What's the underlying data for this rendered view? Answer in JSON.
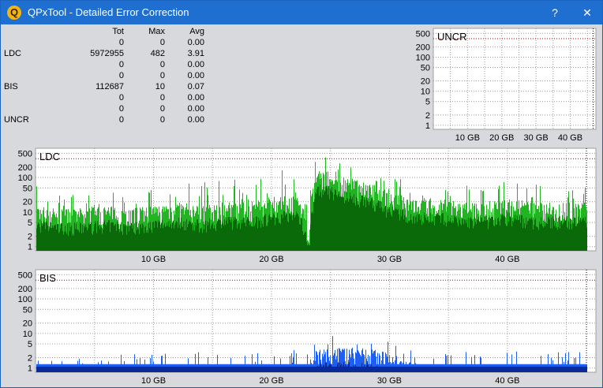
{
  "window": {
    "title": "QPxTool - Detailed Error Correction",
    "help_label": "?",
    "close_label": "✕",
    "app_icon_letter": "Q"
  },
  "stats": {
    "headers": [
      "Tot",
      "Max",
      "Avg"
    ],
    "rows": [
      {
        "label": "",
        "tot": "0",
        "max": "0",
        "avg": "0.00"
      },
      {
        "label": "LDC",
        "tot": "5972955",
        "max": "482",
        "avg": "3.91"
      },
      {
        "label": "",
        "tot": "0",
        "max": "0",
        "avg": "0.00"
      },
      {
        "label": "",
        "tot": "0",
        "max": "0",
        "avg": "0.00"
      },
      {
        "label": "BIS",
        "tot": "112687",
        "max": "10",
        "avg": "0.07"
      },
      {
        "label": "",
        "tot": "0",
        "max": "0",
        "avg": "0.00"
      },
      {
        "label": "",
        "tot": "0",
        "max": "0",
        "avg": "0.00"
      },
      {
        "label": "UNCR",
        "tot": "0",
        "max": "0",
        "avg": "0.00"
      }
    ]
  },
  "colors": {
    "ldc_light": "#22b422",
    "ldc_dark": "#0a6a0a",
    "bis_light": "#1e5ef0",
    "bis_dark": "#0a2a9a",
    "limit_line": "#c00000",
    "titlebar": "#1e6fd0"
  },
  "chart_data": [
    {
      "type": "bar",
      "title": "UNCR",
      "x_range": [
        0,
        47.5
      ],
      "x_unit": "GB",
      "y_scale": "log",
      "y_ticks": [
        "500",
        "200",
        "100",
        "50",
        "20",
        "10",
        "5",
        "2",
        "1"
      ],
      "x_ticks": [
        "10 GB",
        "20 GB",
        "30 GB",
        "40 GB"
      ],
      "series": [
        {
          "x": [
            0,
            46.7
          ],
          "y": [
            0,
            0
          ]
        }
      ]
    },
    {
      "type": "bar",
      "title": "LDC",
      "x_range": [
        0,
        47.5
      ],
      "x_unit": "GB",
      "y_scale": "log",
      "y_ticks": [
        "500",
        "200",
        "100",
        "50",
        "20",
        "10",
        "5",
        "2",
        "1"
      ],
      "x_ticks": [
        "10 GB",
        "20 GB",
        "30 GB",
        "40 GB"
      ],
      "series": [
        {
          "x": [
            0,
            2,
            4,
            6,
            8,
            10,
            12,
            14,
            16,
            18,
            20,
            22,
            23.2,
            24,
            25,
            26,
            27,
            28,
            29,
            30,
            32,
            34,
            36,
            38,
            40,
            42,
            44,
            46.7
          ],
          "y": [
            12,
            10,
            10,
            12,
            10,
            12,
            15,
            12,
            15,
            15,
            20,
            25,
            0,
            130,
            110,
            80,
            70,
            60,
            45,
            30,
            20,
            20,
            15,
            15,
            20,
            15,
            15,
            15
          ],
          "peak_y": [
            60,
            30,
            35,
            40,
            35,
            45,
            80,
            70,
            90,
            90,
            200,
            150,
            0,
            482,
            350,
            250,
            200,
            150,
            120,
            100,
            80,
            70,
            70,
            60,
            80,
            70,
            50,
            60
          ]
        }
      ]
    },
    {
      "type": "bar",
      "title": "BIS",
      "x_range": [
        0,
        47.5
      ],
      "x_unit": "GB",
      "y_scale": "log",
      "y_ticks": [
        "500",
        "200",
        "100",
        "50",
        "20",
        "10",
        "5",
        "2",
        "1"
      ],
      "x_ticks": [
        "10 GB",
        "20 GB",
        "30 GB",
        "40 GB"
      ],
      "series": [
        {
          "x": [
            0,
            5,
            10,
            15,
            20,
            23,
            24,
            26,
            28,
            30,
            32,
            35,
            40,
            46.7
          ],
          "y": [
            1,
            1,
            1,
            1,
            1,
            1,
            3,
            3,
            3,
            2,
            1,
            1,
            1,
            1
          ],
          "peak_y": [
            2,
            2,
            3,
            3,
            3,
            4,
            10,
            8,
            7,
            6,
            4,
            3,
            3,
            3
          ]
        }
      ]
    }
  ]
}
